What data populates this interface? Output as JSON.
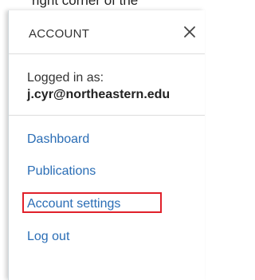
{
  "background_text": "right corner of the",
  "panel": {
    "title": "ACCOUNT",
    "close_icon": "close-icon"
  },
  "user": {
    "logged_in_label": "Logged in as:",
    "email": "j.cyr@northeastern.edu"
  },
  "nav": {
    "items": [
      {
        "label": "Dashboard"
      },
      {
        "label": "Publications"
      },
      {
        "label": "Account settings",
        "highlighted": true
      },
      {
        "label": "Log out"
      }
    ]
  },
  "colors": {
    "link": "#2a6db5",
    "highlight_border": "#e0202a",
    "divider": "#dddddd"
  }
}
